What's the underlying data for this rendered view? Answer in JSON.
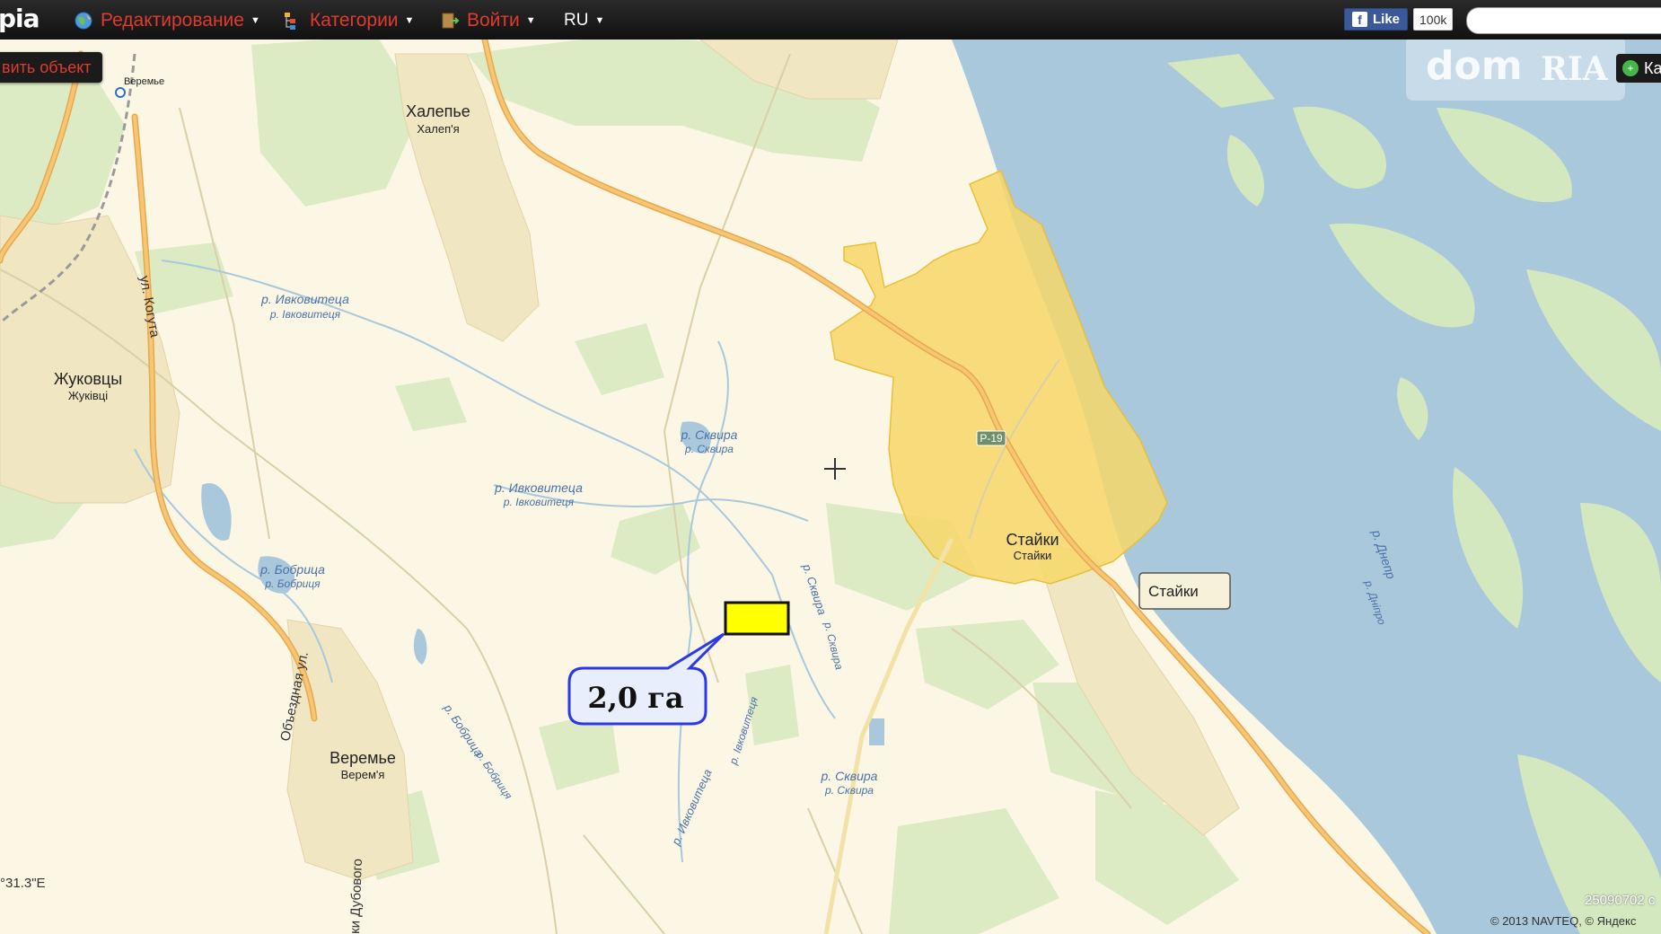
{
  "app": {
    "logo": "pia",
    "menu": [
      {
        "label": "Редактирование",
        "icon": "globe-icon"
      },
      {
        "label": "Категории",
        "icon": "categories-icon"
      },
      {
        "label": "Войти",
        "icon": "login-icon"
      },
      {
        "label": "RU",
        "icon": ""
      }
    ],
    "facebook": {
      "like_label": "Like",
      "count": "100k"
    },
    "add_object_label": "вить объект",
    "ka_label": "Ка",
    "watermark": {
      "left": "dom",
      "right": "RIA"
    }
  },
  "map": {
    "places": [
      {
        "name": "Халепье",
        "sub": "Халеп'я"
      },
      {
        "name": "Жуковцы",
        "sub": "Жуківці"
      },
      {
        "name": "Веремье",
        "sub": "Верем'я"
      },
      {
        "name": "Стайки",
        "sub": "Стайки"
      }
    ],
    "rivers": [
      {
        "name": "р. Ивковитеца",
        "sub": "р. Івковитеця"
      },
      {
        "name": "р. Сквира",
        "sub": "р. Сквира"
      },
      {
        "name": "р. Ивковитеца",
        "sub": "р. Івковитеця"
      },
      {
        "name": "р. Бобрица",
        "sub": "р. Бобриця"
      },
      {
        "name": "р. Сквира",
        "sub": "р. Сквира"
      },
      {
        "name": "р. Днепр",
        "sub": "р. Дніпро"
      }
    ],
    "streets": [
      "ул. Когута",
      "Объездная ул.",
      "ки Дубового",
      "р. Сквира",
      "р. Сквира",
      "р. Бобрица",
      "р. Бобриця",
      "р. Ивковитеца",
      "р. Івковитеця"
    ],
    "small_labels": [
      "Веремье"
    ],
    "road_badge": "Р-19",
    "tooltip": "Стайки",
    "plot_callout": "2,0 га",
    "coordinates": "°31.3\"E",
    "map_id": "25090702 c",
    "copyright": "© 2013 NAVTEQ, © Яндекс"
  },
  "colors": {
    "land": "#fbf7e4",
    "forest": "#dcebc4",
    "water": "#a9c8dc",
    "road": "#f0b35c",
    "settlement": "#f6eccc",
    "highlight": "#f7d768",
    "plot": "#ffff00",
    "callout": "#2a38e8",
    "menu_text": "#e03a2e"
  }
}
